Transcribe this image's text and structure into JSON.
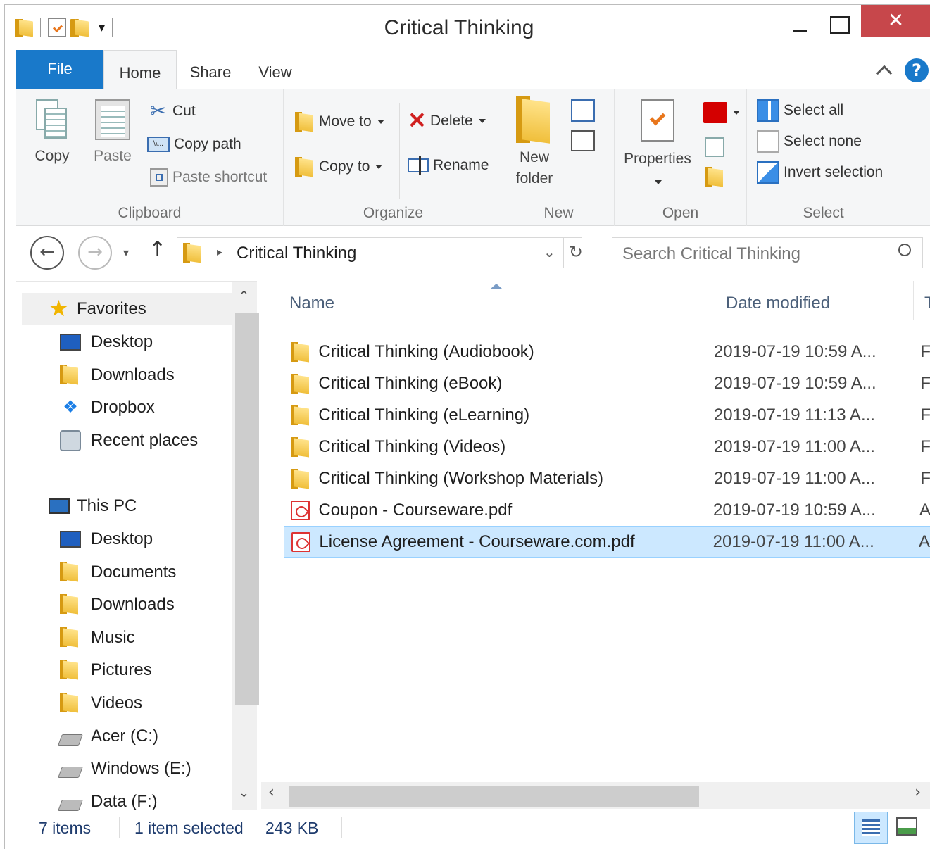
{
  "window": {
    "title": "Critical Thinking",
    "close_glyph": "✕"
  },
  "tabs": {
    "file": "File",
    "home": "Home",
    "share": "Share",
    "view": "View",
    "help": "?"
  },
  "ribbon": {
    "clipboard": {
      "label": "Clipboard",
      "copy": "Copy",
      "paste": "Paste",
      "cut": "Cut",
      "copy_path": "Copy path",
      "paste_shortcut": "Paste shortcut"
    },
    "organize": {
      "label": "Organize",
      "move_to": "Move to",
      "copy_to": "Copy to",
      "delete": "Delete",
      "rename": "Rename"
    },
    "new": {
      "label": "New",
      "new_folder_line1": "New",
      "new_folder_line2": "folder"
    },
    "open": {
      "label": "Open",
      "properties": "Properties"
    },
    "select": {
      "label": "Select",
      "select_all": "Select all",
      "select_none": "Select none",
      "invert": "Invert selection"
    }
  },
  "address": {
    "path": "Critical Thinking",
    "search_placeholder": "Search Critical Thinking"
  },
  "nav": {
    "favorites": "Favorites",
    "fav_items": [
      "Desktop",
      "Downloads",
      "Dropbox",
      "Recent places"
    ],
    "this_pc": "This PC",
    "pc_items": [
      "Desktop",
      "Documents",
      "Downloads",
      "Music",
      "Pictures",
      "Videos",
      "Acer (C:)",
      "Windows (E:)",
      "Data (F:)"
    ]
  },
  "columns": {
    "name": "Name",
    "date": "Date modified",
    "type": "T"
  },
  "files": [
    {
      "name": "Critical Thinking (Audiobook)",
      "date": "2019-07-19 10:59 A...",
      "type": "F",
      "kind": "folder"
    },
    {
      "name": "Critical Thinking (eBook)",
      "date": "2019-07-19 10:59 A...",
      "type": "F",
      "kind": "folder"
    },
    {
      "name": "Critical Thinking (eLearning)",
      "date": "2019-07-19 11:13 A...",
      "type": "F",
      "kind": "folder"
    },
    {
      "name": "Critical Thinking (Videos)",
      "date": "2019-07-19 11:00 A...",
      "type": "F",
      "kind": "folder"
    },
    {
      "name": "Critical Thinking (Workshop Materials)",
      "date": "2019-07-19 11:00 A...",
      "type": "F",
      "kind": "folder"
    },
    {
      "name": "Coupon - Courseware.pdf",
      "date": "2019-07-19 10:59 A...",
      "type": "A",
      "kind": "pdf"
    },
    {
      "name": "License Agreement - Courseware.com.pdf",
      "date": "2019-07-19 11:00 A...",
      "type": "A",
      "kind": "pdf",
      "selected": true
    }
  ],
  "status": {
    "count": "7 items",
    "selected": "1 item selected",
    "size": "243 KB"
  },
  "colors": {
    "file_tab": "#1979ca",
    "close": "#c7474b",
    "selection": "#cce8ff"
  }
}
